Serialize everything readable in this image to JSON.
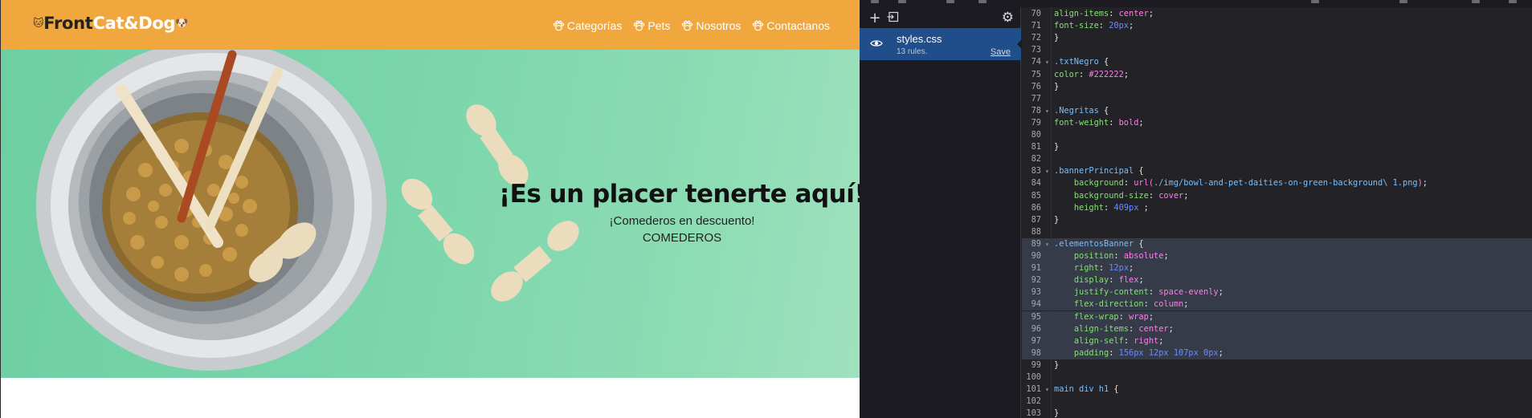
{
  "site": {
    "logo": {
      "part1": "Front",
      "part2": "Cat&Dog",
      "cat_icon": "cat-face-icon"
    },
    "nav": [
      {
        "label": "Categorías",
        "icon": "paw-icon"
      },
      {
        "label": "Pets",
        "icon": "paw-icon"
      },
      {
        "label": "Nosotros",
        "icon": "paw-icon"
      },
      {
        "label": "Contactanos",
        "icon": "paw-icon"
      }
    ],
    "banner": {
      "title": "¡Es un placer tenerte aquí!",
      "subtitle": "¡Comederos en descuento!",
      "cta": "COMEDEROS"
    },
    "colors": {
      "header": "#f0a83e",
      "banner_green": "#7ad5ab"
    }
  },
  "devtools": {
    "sheet": {
      "name": "styles.css",
      "rules": "13 rules.",
      "save_label": "Save"
    },
    "toolbar_icons": [
      "plus-icon",
      "import-icon",
      "gear-icon"
    ],
    "code": [
      {
        "n": "70",
        "f": "",
        "t": [
          [
            "prop",
            "align-items"
          ],
          [
            "punc",
            ": "
          ],
          [
            "val",
            "center"
          ],
          [
            "punc",
            ";"
          ]
        ]
      },
      {
        "n": "71",
        "f": "",
        "t": [
          [
            "prop",
            "font-size"
          ],
          [
            "punc",
            ": "
          ],
          [
            "num",
            "20px"
          ],
          [
            "punc",
            ";"
          ]
        ]
      },
      {
        "n": "72",
        "f": "",
        "t": [
          [
            "punc",
            "}"
          ]
        ]
      },
      {
        "n": "73",
        "f": "",
        "t": []
      },
      {
        "n": "74",
        "f": "▾",
        "t": [
          [
            "sel",
            ".txtNegro"
          ],
          [
            "punc",
            " {"
          ]
        ]
      },
      {
        "n": "75",
        "f": "",
        "t": [
          [
            "prop",
            "color"
          ],
          [
            "punc",
            ": "
          ],
          [
            "val",
            "#222222"
          ],
          [
            "punc",
            ";"
          ]
        ]
      },
      {
        "n": "76",
        "f": "",
        "t": [
          [
            "punc",
            "}"
          ]
        ]
      },
      {
        "n": "77",
        "f": "",
        "t": []
      },
      {
        "n": "78",
        "f": "▾",
        "t": [
          [
            "sel",
            ".Negritas"
          ],
          [
            "punc",
            " {"
          ]
        ]
      },
      {
        "n": "79",
        "f": "",
        "t": [
          [
            "prop",
            "font-weight"
          ],
          [
            "punc",
            ": "
          ],
          [
            "val",
            "bold"
          ],
          [
            "punc",
            ";"
          ]
        ]
      },
      {
        "n": "80",
        "f": "",
        "t": []
      },
      {
        "n": "81",
        "f": "",
        "t": [
          [
            "punc",
            "}"
          ]
        ]
      },
      {
        "n": "82",
        "f": "",
        "t": []
      },
      {
        "n": "83",
        "f": "▾",
        "t": [
          [
            "sel",
            ".bannerPrincipal"
          ],
          [
            "punc",
            " {"
          ]
        ]
      },
      {
        "n": "84",
        "f": "",
        "t": [
          [
            "punc",
            "    "
          ],
          [
            "prop",
            "background"
          ],
          [
            "punc",
            ": "
          ],
          [
            "val",
            "url("
          ],
          [
            "url",
            "./img/bowl-and-pet-daities-on-green-background\\ 1.png"
          ],
          [
            "val",
            ")"
          ],
          [
            "punc",
            ";"
          ]
        ]
      },
      {
        "n": "85",
        "f": "",
        "t": [
          [
            "punc",
            "    "
          ],
          [
            "prop",
            "background-size"
          ],
          [
            "punc",
            ": "
          ],
          [
            "val",
            "cover"
          ],
          [
            "punc",
            ";"
          ]
        ]
      },
      {
        "n": "86",
        "f": "",
        "t": [
          [
            "punc",
            "    "
          ],
          [
            "prop",
            "height"
          ],
          [
            "punc",
            ": "
          ],
          [
            "num",
            "409px"
          ],
          [
            "punc",
            " ;"
          ]
        ]
      },
      {
        "n": "87",
        "f": "",
        "t": [
          [
            "punc",
            "}"
          ]
        ]
      },
      {
        "n": "88",
        "f": "",
        "t": []
      },
      {
        "n": "89",
        "f": "▾",
        "hl": true,
        "t": [
          [
            "sel",
            ".elementosBanner"
          ],
          [
            "punc",
            " {"
          ]
        ]
      },
      {
        "n": "90",
        "f": "",
        "hl": true,
        "t": [
          [
            "punc",
            "    "
          ],
          [
            "prop",
            "position"
          ],
          [
            "punc",
            ": "
          ],
          [
            "val",
            "absolute"
          ],
          [
            "punc",
            ";"
          ]
        ]
      },
      {
        "n": "91",
        "f": "",
        "hl": true,
        "t": [
          [
            "punc",
            "    "
          ],
          [
            "prop",
            "right"
          ],
          [
            "punc",
            ": "
          ],
          [
            "num",
            "12px"
          ],
          [
            "punc",
            ";"
          ]
        ]
      },
      {
        "n": "92",
        "f": "",
        "hl": true,
        "t": [
          [
            "punc",
            "    "
          ],
          [
            "prop",
            "display"
          ],
          [
            "punc",
            ": "
          ],
          [
            "val",
            "flex"
          ],
          [
            "punc",
            ";"
          ]
        ]
      },
      {
        "n": "93",
        "f": "",
        "hl": true,
        "t": [
          [
            "punc",
            "    "
          ],
          [
            "prop",
            "justify-content"
          ],
          [
            "punc",
            ": "
          ],
          [
            "val",
            "space-evenly"
          ],
          [
            "punc",
            ";"
          ]
        ]
      },
      {
        "n": "94",
        "f": "",
        "hl": true,
        "t": [
          [
            "punc",
            "    "
          ],
          [
            "prop",
            "flex-direction"
          ],
          [
            "punc",
            ": "
          ],
          [
            "val",
            "column"
          ],
          [
            "punc",
            ";"
          ]
        ]
      },
      {
        "n": "95",
        "f": "",
        "hl": true,
        "t": [
          [
            "punc",
            "    "
          ],
          [
            "prop",
            "flex-wrap"
          ],
          [
            "punc",
            ": "
          ],
          [
            "val",
            "wrap"
          ],
          [
            "punc",
            ";"
          ]
        ]
      },
      {
        "n": "96",
        "f": "",
        "hl": true,
        "t": [
          [
            "punc",
            "    "
          ],
          [
            "prop",
            "align-items"
          ],
          [
            "punc",
            ": "
          ],
          [
            "val",
            "center"
          ],
          [
            "punc",
            ";"
          ]
        ]
      },
      {
        "n": "97",
        "f": "",
        "hl": true,
        "t": [
          [
            "punc",
            "    "
          ],
          [
            "prop",
            "align-self"
          ],
          [
            "punc",
            ": "
          ],
          [
            "val",
            "right"
          ],
          [
            "punc",
            ";"
          ]
        ]
      },
      {
        "n": "98",
        "f": "",
        "hl": true,
        "t": [
          [
            "punc",
            "    "
          ],
          [
            "prop",
            "padding"
          ],
          [
            "punc",
            ": "
          ],
          [
            "num",
            "156px 12px 107px 0px"
          ],
          [
            "punc",
            ";"
          ]
        ]
      },
      {
        "n": "99",
        "f": "",
        "t": [
          [
            "punc",
            "}"
          ]
        ]
      },
      {
        "n": "100",
        "f": "",
        "t": []
      },
      {
        "n": "101",
        "f": "▾",
        "t": [
          [
            "sel",
            "main div h1"
          ],
          [
            "punc",
            " {"
          ]
        ]
      },
      {
        "n": "102",
        "f": "",
        "t": []
      },
      {
        "n": "103",
        "f": "",
        "t": [
          [
            "punc",
            "}"
          ]
        ]
      }
    ]
  }
}
